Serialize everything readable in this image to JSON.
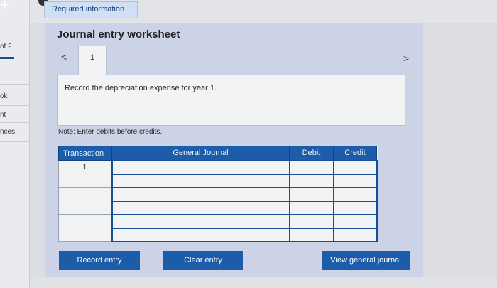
{
  "sidebar": {
    "items": [
      {
        "label": "of 2"
      },
      {
        "label": "ok"
      },
      {
        "label": "nt"
      },
      {
        "label": "nces"
      }
    ]
  },
  "tabs": {
    "required_info": "Required information"
  },
  "worksheet": {
    "title": "Journal entry worksheet",
    "prev_icon": "<",
    "next_icon": ">",
    "entry_tab": "1",
    "instruction": "Record the depreciation expense for year 1.",
    "note": "Note: Enter debits before credits."
  },
  "table": {
    "headers": [
      "Transaction",
      "General Journal",
      "Debit",
      "Credit"
    ],
    "rows": [
      {
        "transaction": "1",
        "account": "",
        "debit": "",
        "credit": ""
      },
      {
        "transaction": "",
        "account": "",
        "debit": "",
        "credit": ""
      },
      {
        "transaction": "",
        "account": "",
        "debit": "",
        "credit": ""
      },
      {
        "transaction": "",
        "account": "",
        "debit": "",
        "credit": ""
      },
      {
        "transaction": "",
        "account": "",
        "debit": "",
        "credit": ""
      },
      {
        "transaction": "",
        "account": "",
        "debit": "",
        "credit": ""
      }
    ]
  },
  "buttons": {
    "record": "Record entry",
    "clear": "Clear entry",
    "view": "View general journal"
  },
  "colors": {
    "accent": "#1d5ca8",
    "panel": "#cdd3e7"
  }
}
